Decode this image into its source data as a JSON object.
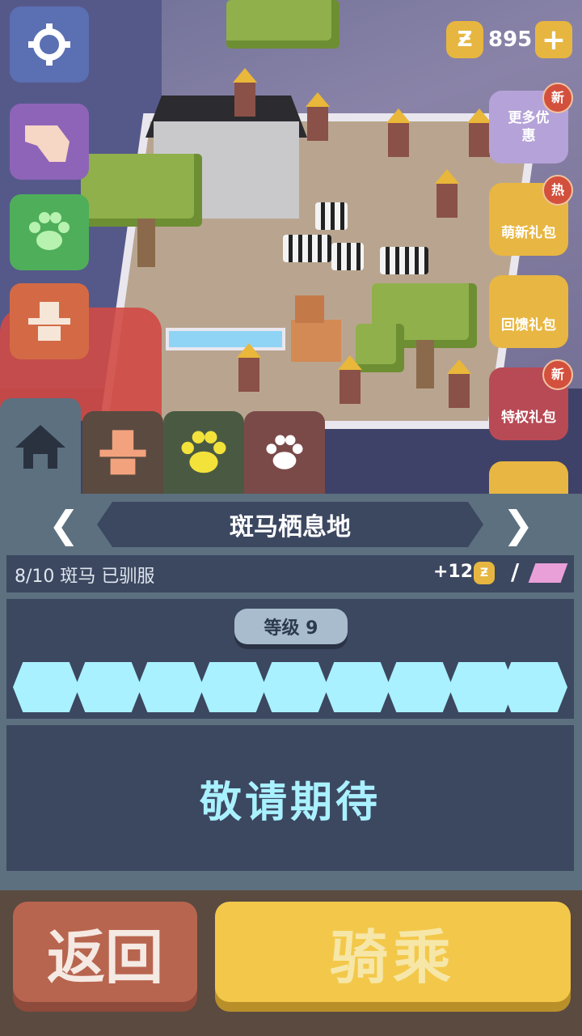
{
  "currency": {
    "icon": "zoo-coin-icon",
    "amount": "895"
  },
  "right_menu": [
    {
      "label": "更多优惠",
      "badge": "新",
      "color": "#b5a2d8"
    },
    {
      "label": "萌新礼包",
      "badge": "热",
      "color": "#e8b642"
    },
    {
      "label": "回馈礼包",
      "badge": "",
      "color": "#e8b642"
    },
    {
      "label": "特权礼包",
      "badge": "新",
      "color": "#b84a56"
    }
  ],
  "left_menu": [
    {
      "icon": "settings-gear-icon",
      "color": "#5b6fb3"
    },
    {
      "icon": "hand-pointer-icon",
      "color": "#8e64b8"
    },
    {
      "icon": "paw-icon",
      "color": "#4fae5a"
    },
    {
      "icon": "cowboy-hat-icon",
      "color": "#d46a45"
    }
  ],
  "tabs": [
    {
      "icon": "home-icon",
      "color": "#5c7080"
    },
    {
      "icon": "cowboy-hat-icon",
      "color": "#5a4a40"
    },
    {
      "icon": "paw-icon",
      "color": "#4a5a42"
    },
    {
      "icon": "paw-icon",
      "color": "#7a4a48"
    }
  ],
  "habitat": {
    "title": "斑马栖息地",
    "tamed": "8/10 斑马 已驯服",
    "reward": "+12",
    "separator": "/",
    "level_label": "等级 9",
    "level_progress_segments": 9,
    "coming_soon": "敬请期待"
  },
  "buttons": {
    "back": "返回",
    "ride": "骑乘"
  }
}
